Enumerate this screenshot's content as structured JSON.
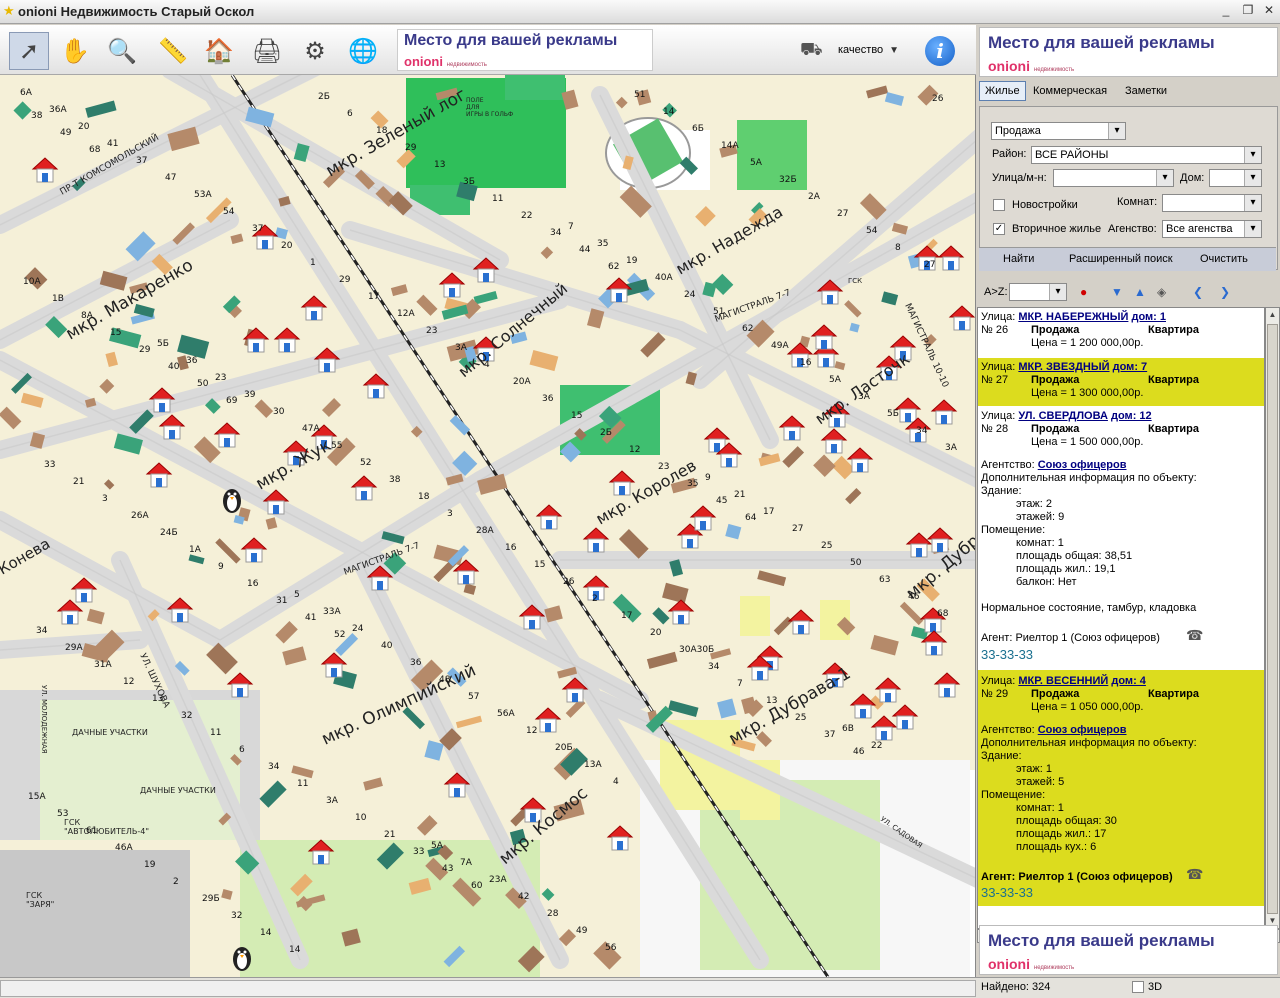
{
  "window": {
    "title": "onioni Недвижимость Старый Оскол",
    "minimize": "_",
    "restore": "❐",
    "close": "✕"
  },
  "toolbar": {
    "tools": [
      {
        "name": "pointer-tool",
        "glyph": "➚"
      },
      {
        "name": "pan-tool",
        "glyph": "✋"
      },
      {
        "name": "zoom-tool",
        "glyph": "🔍"
      },
      {
        "name": "measure-tool",
        "glyph": "📏"
      },
      {
        "name": "home-tool",
        "glyph": "🏠"
      },
      {
        "name": "print-tool",
        "glyph": "🖨"
      },
      {
        "name": "settings-tool",
        "glyph": "⚙"
      },
      {
        "name": "web-tool",
        "glyph": "🌐"
      }
    ],
    "quality_label": "качество",
    "info_label": "i"
  },
  "ad": {
    "title": "Место для вашей рекламы",
    "logo": "onioni",
    "logo_sub": "недвижимость"
  },
  "tabs": [
    "Жилье",
    "Коммерческая",
    "Заметки"
  ],
  "filter": {
    "deal": "Продажа",
    "district_label": "Район:",
    "district": "ВСЕ РАЙОНЫ",
    "street_label": "Улица/м-н:",
    "street": "",
    "house_label": "Дом:",
    "house": "",
    "new_label": "Новостройки",
    "new_checked": false,
    "rooms_label": "Комнат:",
    "rooms": "",
    "secondary_label": "Вторичное жилье",
    "secondary_checked": true,
    "agency_label": "Агенство:",
    "agency": "Все агенства",
    "find": "Найти",
    "advanced": "Расширенный поиск",
    "clear": "Очистить"
  },
  "listbar": {
    "sort_label": "A>Z:",
    "sort_value": ""
  },
  "results": [
    {
      "street_label": "Улица:",
      "street": "МКР. НАБЕРЕЖНЫЙ",
      "house": "дом: 1",
      "num": "№ 26",
      "deal": "Продажа",
      "type": "Квартира",
      "price": "Цена = 1 200 000,00р.",
      "highlight": false
    },
    {
      "street_label": "Улица:",
      "street": "МКР. ЗВЕЗДНЫЙ",
      "house": "дом: 7",
      "num": "№ 27",
      "deal": "Продажа",
      "type": "Квартира",
      "price": "Цена = 1 300 000,00р.",
      "highlight": true
    },
    {
      "street_label": "Улица:",
      "street": "УЛ. СВЕРДЛОВА",
      "house": "дом: 12",
      "num": "№ 28",
      "deal": "Продажа",
      "type": "Квартира",
      "price": "Цена = 1 500 000,00р.",
      "highlight": false
    },
    {
      "street_label": "Улица:",
      "street": "МКР. ВЕСЕННИЙ",
      "house": "дом: 4",
      "num": "№ 29",
      "deal": "Продажа",
      "type": "Квартира",
      "price": "Цена = 1 050 000,00р.",
      "highlight": true
    }
  ],
  "detail28": {
    "agency_label": "Агентство:",
    "agency": "Союз офицеров",
    "extra": "Дополнительная информация по объекту:",
    "building": "Здание:",
    "floor": "этаж: 2",
    "floors": "этажей: 9",
    "room_head": "Помещение:",
    "rooms": "комнат: 1",
    "area_total": "площадь общая: 38,51",
    "area_live": "площадь жил.: 19,1",
    "balcony": "балкон: Нет",
    "note": "Нормальное состояние, тамбур, кладовка",
    "agent": "Агент: Риелтор 1 (Союз офицеров)",
    "phone": "33-33-33"
  },
  "detail29": {
    "agency_label": "Агентство:",
    "agency": "Союз офицеров",
    "extra": "Дополнительная информация по объекту:",
    "building": "Здание:",
    "floor": "этаж: 1",
    "floors": "этажей: 5",
    "room_head": "Помещение:",
    "rooms": "комнат: 1",
    "area_total": "площадь общая: 30",
    "area_live": "площадь жил.: 17",
    "area_kitchen": "площадь кух.: 6",
    "agent": "Агент: Риелтор 1 (Союз офицеров)",
    "phone": "33-33-33"
  },
  "status": {
    "found": "Найдено: 324",
    "view3d": "3D"
  },
  "map_labels": {
    "golf": "ПОЛЕ\nДЛЯ\nИГРЫ В ГОЛЬФ",
    "zeleny": "мкр. Зеленый лог",
    "nadezhda": "мкр. Надежда",
    "komsomolsky": "ПР-Т КОМСОМОЛЬСКИЙ",
    "makarenko": "мкр. Макаренко",
    "solnechny": "мкр. Солнечный",
    "magistral77a": "МАГИСТРАЛЬ 7-7",
    "magistral77b": "МАГИСТРАЛЬ 7-7",
    "magistral1010": "МАГИСТРАЛЬ 10-10",
    "rastochka": "мкр. Ласточк",
    "korolev": "мкр. Королев",
    "zhuk": "мкр. Жук",
    "konev": "Конева",
    "shukhov": "УЛ. ШУХОВА",
    "olimpiysky": "мкр. Олимпийский",
    "dubrava1": "мкр. Дубрава-1",
    "dubrava": "мкр. Дубрава",
    "kosmos": "мкр. Космос",
    "dachnye1": "ДАЧНЫЕ УЧАСТКИ",
    "dachnye2": "ДАЧНЫЕ УЧАСТКИ",
    "gsk_avto": "ГСК\n\"АВТОЛЮБИТЕЛЬ-4\"",
    "gsk_zarya": "ГСК\n\"ЗАРЯ\"",
    "gsk": "ГСК",
    "ul_molodezh": "УЛ. МОЛОДЕЖНАЯ",
    "ul_sadovaya": "УЛ. САДОВАЯ"
  },
  "numbers": [
    "6А",
    "5Б",
    "5",
    "5А",
    "7",
    "9",
    "6В",
    "36А",
    "36",
    "33А",
    "7А",
    "35",
    "21",
    "22",
    "20",
    "23",
    "24",
    "23А",
    "19",
    "17",
    "20А",
    "41",
    "39",
    "40",
    "42",
    "40А",
    "27",
    "58",
    "37",
    "30",
    "36",
    "28",
    "24",
    "25",
    "15А",
    "47",
    "47А",
    "48",
    "49",
    "51",
    "50",
    "53",
    "53А",
    "55",
    "57",
    "56",
    "62",
    "63",
    "61",
    "54",
    "52",
    "56А",
    "51",
    "49А",
    "46",
    "46А",
    "37",
    "38",
    "12",
    "14",
    "16",
    "68",
    "19",
    "20",
    "18",
    "20Б",
    "6Б",
    "5А",
    "34",
    "2",
    "1",
    "3",
    "13А",
    "14А",
    "3А",
    "29А",
    "29Б",
    "29",
    "28А",
    "4",
    "5А",
    "5Б",
    "31А",
    "32",
    "17",
    "16",
    "32А",
    "32Б",
    "34",
    "12",
    "14",
    "12А",
    "15",
    "5",
    "2А",
    "3А",
    "13",
    "14",
    "23",
    "26",
    "24",
    "27",
    "33",
    "32",
    "2Б",
    "3А",
    "2",
    "1",
    "54",
    "21",
    "11",
    "6",
    "4",
    "17",
    "9",
    "8",
    "3",
    "6",
    "18",
    "20А",
    "20",
    "23",
    "27",
    "26А",
    "34",
    "29",
    "36",
    "30А30Б",
    "26",
    "10А",
    "24Б",
    "11",
    "13",
    "15",
    "34",
    "1Б",
    "1В",
    "1А",
    "3А",
    "3Б",
    "2Б",
    "7",
    "6А",
    "8А",
    "9",
    "10",
    "11",
    "12",
    "13",
    "14",
    "15",
    "16",
    "21",
    "22",
    "23",
    "25",
    "26",
    "29",
    "31",
    "33",
    "34",
    "35",
    "37",
    "38",
    "40",
    "41",
    "43",
    "44",
    "45",
    "46",
    "49",
    "50",
    "52",
    "60",
    "62",
    "64",
    "67",
    "68",
    "69"
  ]
}
